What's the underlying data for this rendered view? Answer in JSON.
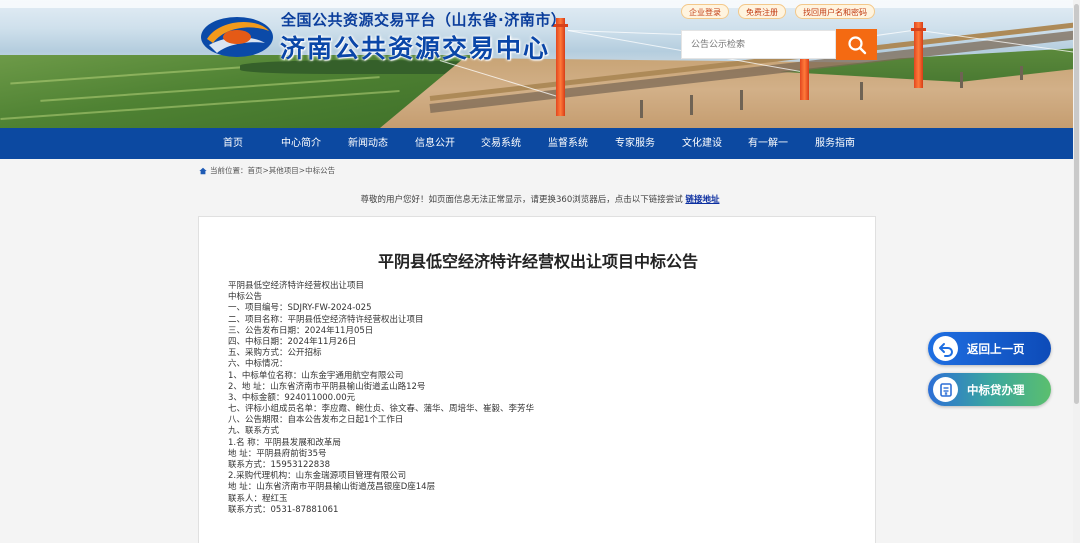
{
  "header": {
    "title_top": "全国公共资源交易平台（山东省·济南市）",
    "title_main": "济南公共资源交易中心",
    "top_links": [
      "企业登录",
      "免费注册",
      "找回用户名和密码"
    ],
    "search_placeholder": "公告公示检索",
    "colors": {
      "brand_blue": "#0c49a1",
      "search_orange": "#f46a12"
    }
  },
  "nav": {
    "items": [
      "首页",
      "中心简介",
      "新闻动态",
      "信息公开",
      "交易系统",
      "监督系统",
      "专家服务",
      "文化建设",
      "有一解一",
      "服务指南"
    ]
  },
  "breadcrumb": {
    "prefix": "当前位置：",
    "items": [
      "首页",
      ">",
      "其他项目",
      ">",
      "中标公告"
    ]
  },
  "notice": {
    "text": "尊敬的用户您好！如页面信息无法正常显示，请更换360浏览器后，点击以下链接尝试",
    "link": "链接地址"
  },
  "article": {
    "title": "平阴县低空经济特许经营权出让项目中标公告",
    "lines": [
      "平阴县低空经济特许经营权出让项目",
      "中标公告",
      "一、项目编号：SDJRY-FW-2024-025",
      "二、项目名称：平阴县低空经济特许经营权出让项目",
      "三、公告发布日期：2024年11月05日",
      "四、中标日期：2024年11月26日",
      "五、采购方式：公开招标",
      "六、中标情况：",
      "1、中标单位名称：山东金宇通用航空有限公司",
      "2、地 址：山东省济南市平阴县榆山街道孟山路12号",
      "3、中标金额：924011000.00元",
      "七、评标小组成员名单：李应霞、鲍仕贞、徐文春、蒲华、周培华、崔毅、李芳华",
      "八、公告期限：自本公告发布之日起1个工作日",
      "九、联系方式",
      "1.名 称：平阴县发展和改革局",
      "地 址：平阴县府前街35号",
      "联系方式：15953122838",
      "2.采购代理机构：山东金瑞源项目管理有限公司",
      "地 址：山东省济南市平阴县榆山街道茂昌银座D座14层",
      "联系人：程红玉",
      "联系方式：0531-87881061"
    ]
  },
  "floating": {
    "back_label": "返回上一页",
    "loan_label": "中标贷办理"
  }
}
